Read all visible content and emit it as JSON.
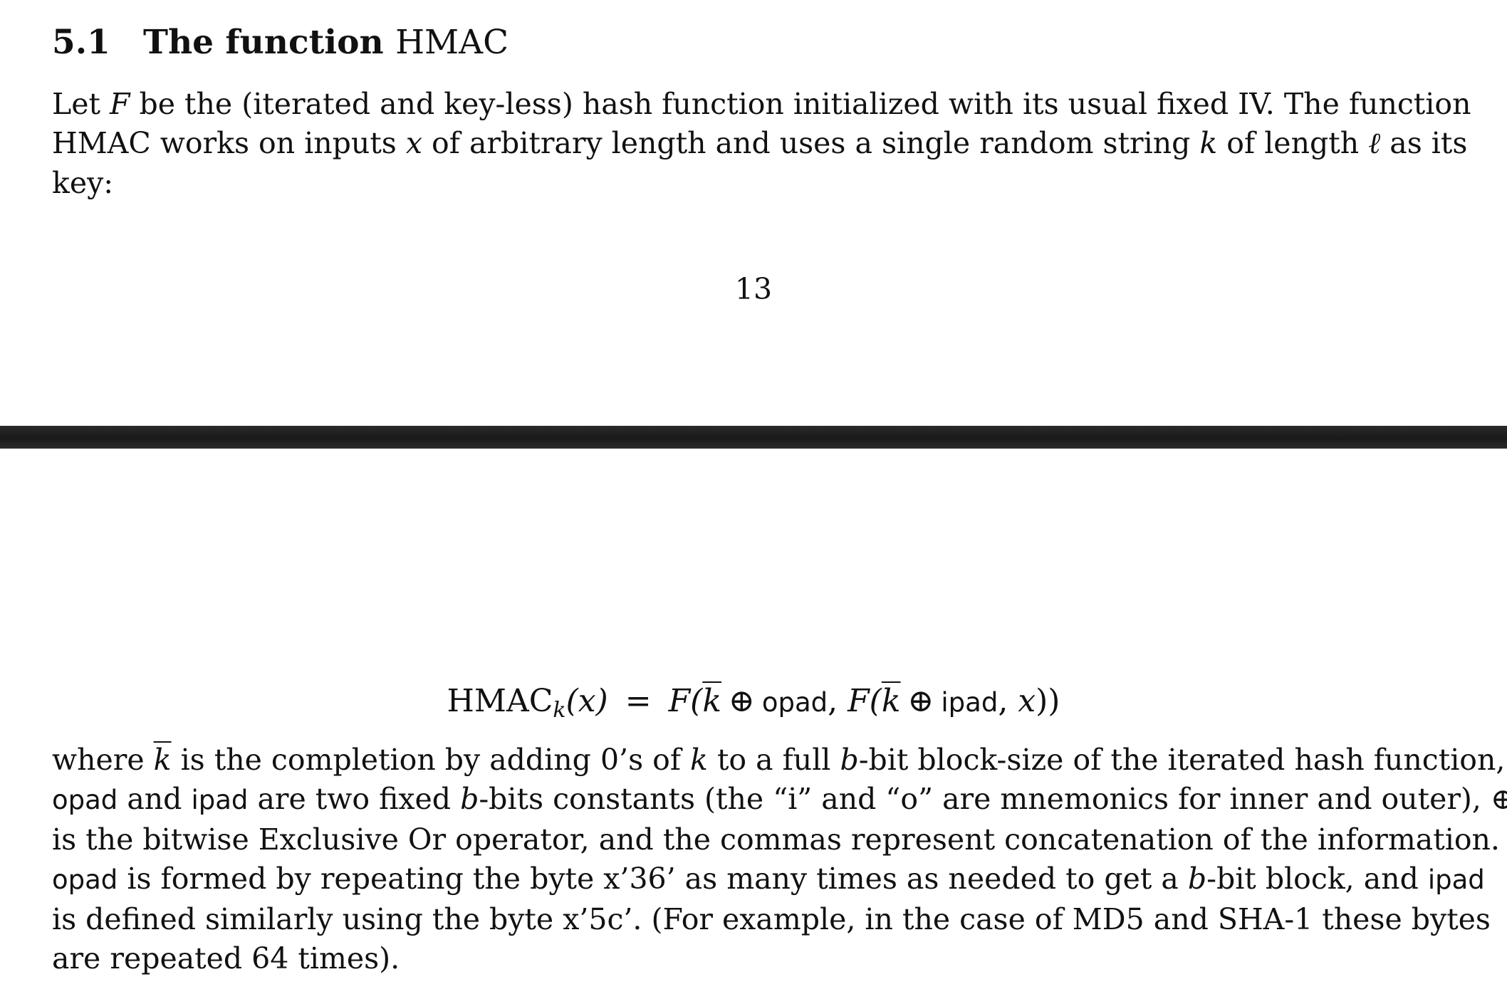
{
  "section": {
    "number": "5.1",
    "title_bold": "The function",
    "title_plain": "HMAC"
  },
  "intro": {
    "line1": {
      "a": "Let ",
      "F": "F",
      "b": " be the (iterated and key-less) hash function initialized with its usual fixed IV. The function"
    },
    "line2": {
      "a": "HMAC works on inputs ",
      "x": "x",
      "b": " of arbitrary length and uses a single random string ",
      "k": "k",
      "c": " of length ",
      "l": "ℓ",
      "d": " as its"
    },
    "line3": "key:"
  },
  "page_number": "13",
  "equation": {
    "lhs_name": "HMAC",
    "lhs_sub": "k",
    "lhs_arg": "(x)",
    "eq": "=",
    "F1": "F(",
    "kbar1": "k",
    "xor1": "⊕",
    "opad": "opad",
    "comma1": ", ",
    "F2": "F(",
    "kbar2": "k",
    "xor2": "⊕",
    "ipad": "ipad",
    "comma2": ", ",
    "x": "x",
    "close": "))"
  },
  "where": {
    "line1": {
      "a": "where ",
      "kbar": "k",
      "b": " is the completion by adding 0’s of ",
      "k": "k",
      "c": " to a full ",
      "bvar": "b",
      "d": "-bit block-size of the iterated hash function,"
    },
    "line2": {
      "opad": "opad",
      "a": " and ",
      "ipad": "ipad",
      "b": " are two fixed ",
      "bvar": "b",
      "c": "-bits constants (the “i” and “o” are mnemonics for inner and outer), ",
      "xor": "⊕"
    },
    "line3": "is the bitwise Exclusive Or operator, and the commas represent concatenation of the information.",
    "line4": {
      "opad": "opad",
      "a": " is formed by repeating the byte x’36’ as many times as needed to get a ",
      "bvar": "b",
      "b": "-bit block, and ",
      "ipad": "ipad"
    },
    "line5": "is defined similarly using the byte x’5c’. (For example, in the case of MD5 and SHA-1 these bytes",
    "line6": "are repeated 64 times)."
  },
  "colors": {
    "text": "#111111",
    "page": "#ffffff",
    "page_gap": "#1e1e1e"
  }
}
